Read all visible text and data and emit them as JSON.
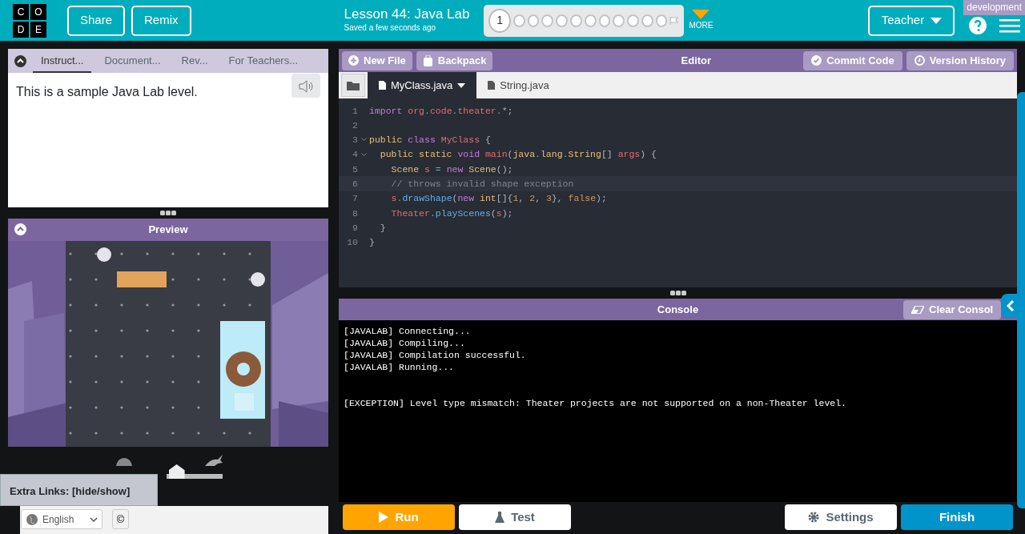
{
  "header": {
    "logo_letters": [
      "C",
      "O",
      "D",
      "E"
    ],
    "buttons": [
      "Share",
      "Remix"
    ],
    "lesson_title": "Lesson 44: Java Lab",
    "save_status": "Saved a few seconds ago",
    "progress": [
      {
        "label": "1",
        "selected": true
      },
      {
        "selected": false
      },
      {
        "selected": false
      },
      {
        "selected": false
      },
      {
        "selected": false
      },
      {
        "selected": false
      },
      {
        "selected": false
      },
      {
        "selected": false
      },
      {
        "selected": false
      },
      {
        "selected": false
      },
      {
        "selected": false
      },
      {
        "selected": false
      }
    ],
    "more_label": "MORE",
    "role_menu": "Teacher",
    "environment_badge": "development"
  },
  "instructions": {
    "tabs": [
      {
        "label": "Instruct...",
        "selected": true
      },
      {
        "label": "Document...",
        "selected": false
      },
      {
        "label": "Rev...",
        "selected": false
      },
      {
        "label": "For Teachers...",
        "selected": false
      }
    ],
    "text": "This is a sample Java Lab level."
  },
  "preview": {
    "title": "Preview",
    "speed": {
      "level": 0.18
    }
  },
  "extra_links": {
    "label": "Extra Links:",
    "link": "[hide/show]"
  },
  "footer": {
    "language": "English",
    "copyright": "©"
  },
  "editor": {
    "buttons": [
      "New File",
      "Backpack"
    ],
    "title": "Editor",
    "actions": [
      "Commit Code",
      "Version History"
    ],
    "files": [
      {
        "name": "MyClass.java",
        "selected": true
      },
      {
        "name": "String.java",
        "selected": false
      }
    ],
    "lines": [
      {
        "number": "1",
        "tokens": [
          {
            "text": "import ",
            "kind": "keyword"
          },
          {
            "text": "org",
            "kind": "ident"
          },
          {
            "text": ".",
            "kind": "op"
          },
          {
            "text": "code",
            "kind": "ident"
          },
          {
            "text": ".",
            "kind": "op"
          },
          {
            "text": "theater",
            "kind": "ident"
          },
          {
            "text": ".",
            "kind": "op"
          },
          {
            "text": "*;",
            "kind": "plain"
          }
        ]
      },
      {
        "number": "2"
      },
      {
        "number": "3",
        "foldable": true,
        "tokens": [
          {
            "text": "public ",
            "kind": "type"
          },
          {
            "text": "class ",
            "kind": "keyword"
          },
          {
            "text": "MyClass",
            "kind": "ident"
          },
          {
            "text": " {",
            "kind": "plain"
          }
        ]
      },
      {
        "number": "4",
        "foldable": true,
        "tokens": [
          {
            "text": "  public static ",
            "kind": "type"
          },
          {
            "text": "void ",
            "kind": "keyword"
          },
          {
            "text": "main",
            "kind": "ident"
          },
          {
            "text": "(",
            "kind": "plain"
          },
          {
            "text": "java",
            "kind": "type"
          },
          {
            "text": ".",
            "kind": "op"
          },
          {
            "text": "lang",
            "kind": "type"
          },
          {
            "text": ".",
            "kind": "op"
          },
          {
            "text": "String",
            "kind": "type"
          },
          {
            "text": "[] ",
            "kind": "plain"
          },
          {
            "text": "args",
            "kind": "ident"
          },
          {
            "text": ") {",
            "kind": "plain"
          }
        ]
      },
      {
        "number": "5",
        "tokens": [
          {
            "text": "    Scene ",
            "kind": "type"
          },
          {
            "text": "s ",
            "kind": "ident"
          },
          {
            "text": "= ",
            "kind": "op"
          },
          {
            "text": "new ",
            "kind": "keyword"
          },
          {
            "text": "Scene",
            "kind": "type"
          },
          {
            "text": "();",
            "kind": "plain"
          }
        ]
      },
      {
        "number": "6",
        "active": true,
        "tokens": [
          {
            "text": "    // throws invalid shape exception",
            "kind": "comment"
          }
        ]
      },
      {
        "number": "7",
        "tokens": [
          {
            "text": "    s",
            "kind": "ident"
          },
          {
            "text": ".",
            "kind": "op"
          },
          {
            "text": "drawShape",
            "kind": "func"
          },
          {
            "text": "(",
            "kind": "plain"
          },
          {
            "text": "new ",
            "kind": "keyword"
          },
          {
            "text": "int",
            "kind": "type"
          },
          {
            "text": "[]{",
            "kind": "plain"
          },
          {
            "text": "1",
            "kind": "number"
          },
          {
            "text": ", ",
            "kind": "plain"
          },
          {
            "text": "2",
            "kind": "number"
          },
          {
            "text": ", ",
            "kind": "plain"
          },
          {
            "text": "3",
            "kind": "number"
          },
          {
            "text": "}, ",
            "kind": "plain"
          },
          {
            "text": "false",
            "kind": "number"
          },
          {
            "text": ");",
            "kind": "plain"
          }
        ]
      },
      {
        "number": "8",
        "tokens": [
          {
            "text": "    Theater",
            "kind": "ident"
          },
          {
            "text": ".",
            "kind": "op"
          },
          {
            "text": "playScenes",
            "kind": "func"
          },
          {
            "text": "(",
            "kind": "plain"
          },
          {
            "text": "s",
            "kind": "ident"
          },
          {
            "text": ");",
            "kind": "plain"
          }
        ]
      },
      {
        "number": "9",
        "tokens": [
          {
            "text": "  }",
            "kind": "plain"
          }
        ]
      },
      {
        "number": "10",
        "tokens": [
          {
            "text": "}",
            "kind": "plain"
          }
        ]
      }
    ]
  },
  "console": {
    "title": "Console",
    "clear_button": "Clear Consol",
    "lines": [
      {
        "text": "[JAVALAB] Connecting...",
        "kind": "log"
      },
      {
        "text": "[JAVALAB] Compiling...",
        "kind": "log"
      },
      {
        "text": "[JAVALAB] Compilation successful.",
        "kind": "log"
      },
      {
        "text": "[JAVALAB] Running...",
        "kind": "log"
      },
      {
        "text": "[EXCEPTION] Level type mismatch: Theater projects are not supported on a non-Theater level.",
        "kind": "exception"
      }
    ]
  },
  "controls": {
    "run": "Run",
    "test": "Test",
    "settings": "Settings",
    "finish": "Finish"
  }
}
